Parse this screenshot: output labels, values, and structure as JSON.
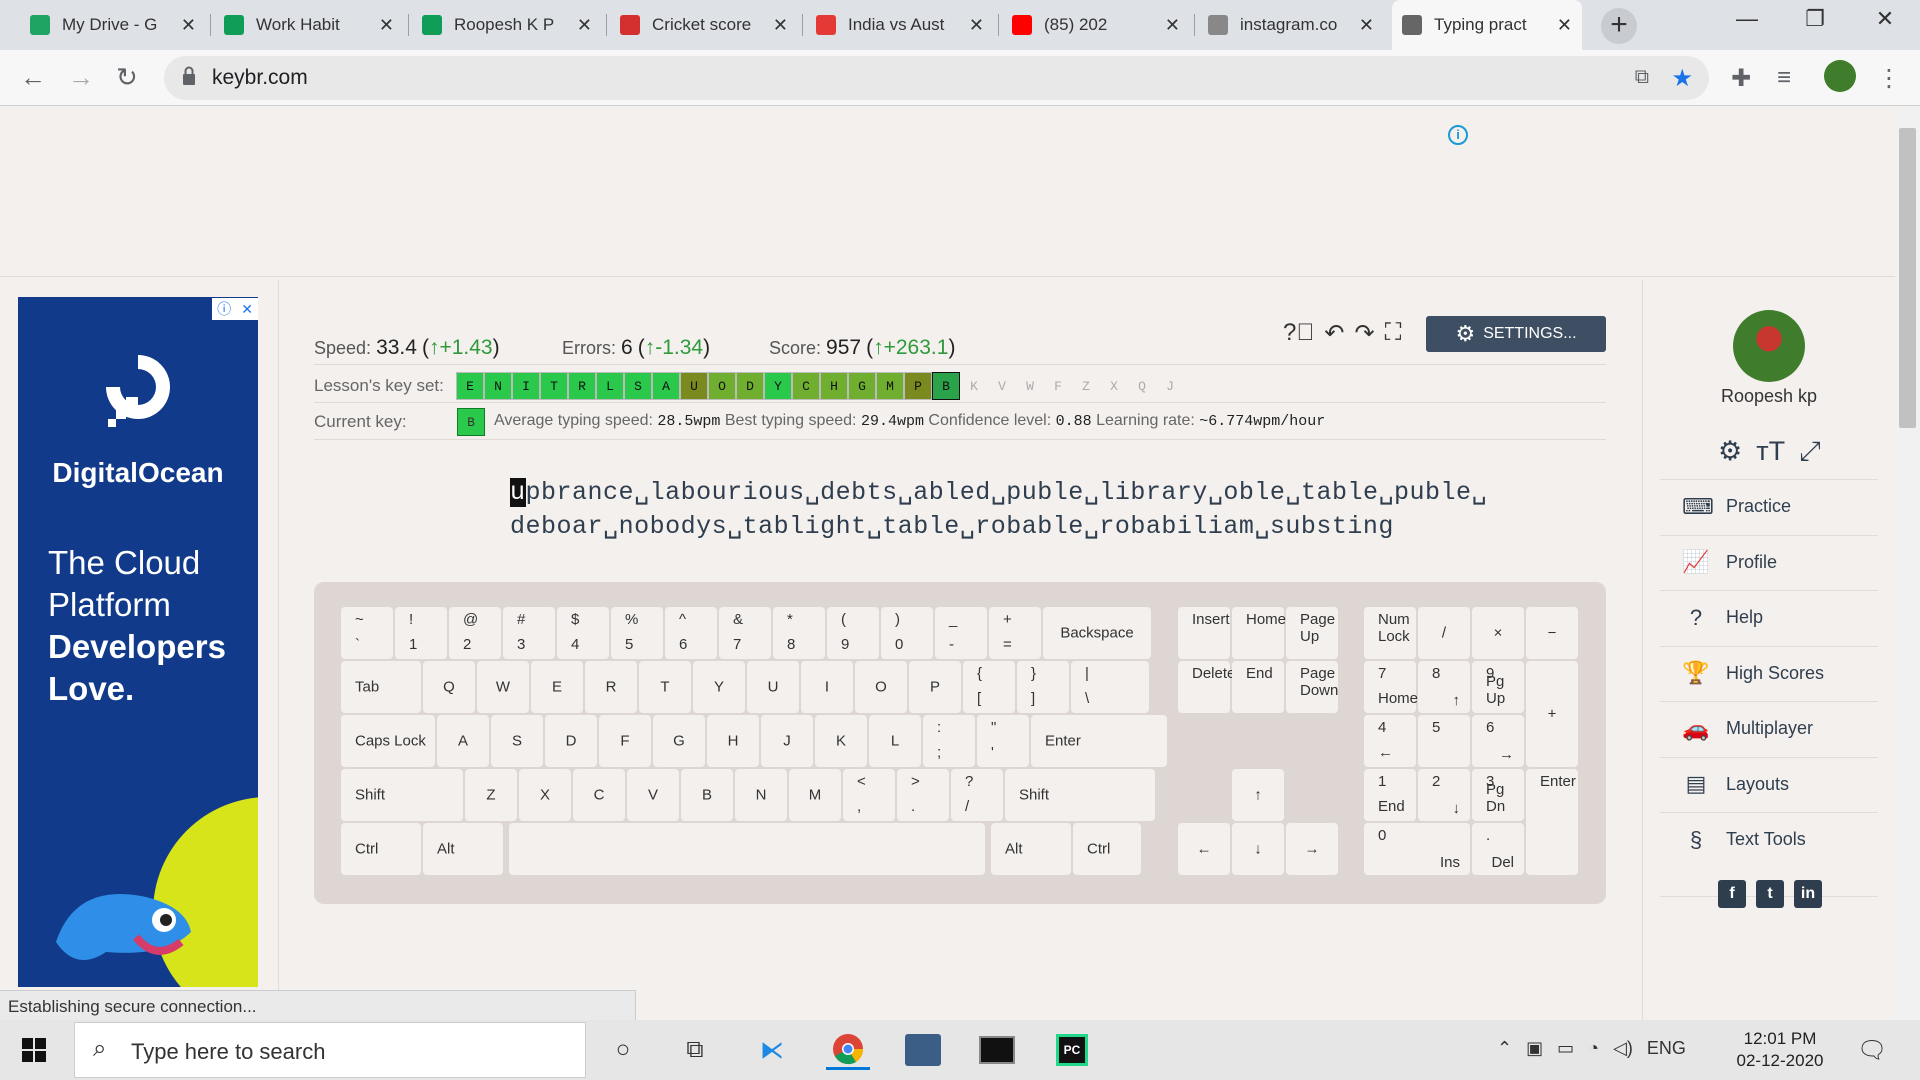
{
  "browser": {
    "tabs": [
      {
        "label": "My Drive - G",
        "favicon": "google-drive-icon",
        "color": "#1fa463"
      },
      {
        "label": "Work Habit",
        "favicon": "google-sheets-icon",
        "color": "#0f9d58"
      },
      {
        "label": "Roopesh K P",
        "favicon": "google-sheets-icon",
        "color": "#0f9d58"
      },
      {
        "label": "Cricket score",
        "favicon": "cricket-icon",
        "color": "#d32f2f"
      },
      {
        "label": "India vs Aust",
        "favicon": "india-vs-aus-icon",
        "color": "#e53935"
      },
      {
        "label": "(85) 202",
        "favicon": "youtube-icon",
        "color": "#ff0000"
      },
      {
        "label": "instagram.co",
        "favicon": "globe-icon",
        "color": "#888888"
      },
      {
        "label": "Typing pract",
        "favicon": "keybr-icon",
        "color": "#666666"
      }
    ],
    "url": "keybr.com"
  },
  "ad": {
    "brand": "DigitalOcean",
    "tag_line1": "The Cloud",
    "tag_line2": "Platform",
    "tag_line3": "Developers",
    "tag_line4": "Love."
  },
  "stats": {
    "speed_label": "Speed:",
    "speed_value": "33.4",
    "speed_delta": "↑+1.43",
    "errors_label": "Errors:",
    "errors_value": "6",
    "errors_delta": "↑-1.34",
    "score_label": "Score:",
    "score_value": "957",
    "score_delta": "↑+263.1"
  },
  "settings_label": "SETTINGS...",
  "lesson": {
    "keyset_label": "Lesson's key set:",
    "keys": [
      {
        "k": "E",
        "s": "g"
      },
      {
        "k": "N",
        "s": "g"
      },
      {
        "k": "I",
        "s": "g"
      },
      {
        "k": "T",
        "s": "g"
      },
      {
        "k": "R",
        "s": "g"
      },
      {
        "k": "L",
        "s": "g"
      },
      {
        "k": "S",
        "s": "g"
      },
      {
        "k": "A",
        "s": "g"
      },
      {
        "k": "U",
        "s": "o"
      },
      {
        "k": "O",
        "s": "m"
      },
      {
        "k": "D",
        "s": "m"
      },
      {
        "k": "Y",
        "s": "g"
      },
      {
        "k": "C",
        "s": "m"
      },
      {
        "k": "H",
        "s": "m"
      },
      {
        "k": "G",
        "s": "m"
      },
      {
        "k": "M",
        "s": "m"
      },
      {
        "k": "P",
        "s": "o"
      },
      {
        "k": "B",
        "s": "c"
      },
      {
        "k": "K",
        "s": "x"
      },
      {
        "k": "V",
        "s": "x"
      },
      {
        "k": "W",
        "s": "x"
      },
      {
        "k": "F",
        "s": "x"
      },
      {
        "k": "Z",
        "s": "x"
      },
      {
        "k": "X",
        "s": "x"
      },
      {
        "k": "Q",
        "s": "x"
      },
      {
        "k": "J",
        "s": "x"
      }
    ],
    "current_label": "Current key:",
    "current_key": "B",
    "avg_label": "Average typing speed:",
    "avg_value": "28.5wpm",
    "best_label": "Best typing speed:",
    "best_value": "29.4wpm",
    "conf_label": "Confidence level:",
    "conf_value": "0.88",
    "rate_label": "Learning rate:",
    "rate_value": "~6.774wpm/hour"
  },
  "text": {
    "cursor": "u",
    "line1_rest": "pbrance␣labourious␣debts␣abled␣puble␣library␣oble␣table␣puble␣",
    "line2": "deboar␣nobodys␣tablight␣table␣robable␣robabiliam␣substing"
  },
  "keyboard": {
    "row1": [
      [
        "~",
        "`"
      ],
      [
        "!",
        "1"
      ],
      [
        "@",
        "2"
      ],
      [
        "#",
        "3"
      ],
      [
        "$",
        "4"
      ],
      [
        "%",
        "5"
      ],
      [
        "^",
        "6"
      ],
      [
        "&",
        "7"
      ],
      [
        "*",
        "8"
      ],
      [
        "(",
        "9"
      ],
      [
        ")",
        "0"
      ],
      [
        "_",
        "-"
      ],
      [
        "+",
        "="
      ]
    ],
    "backspace": "Backspace",
    "tab": "Tab",
    "row2": [
      "Q",
      "W",
      "E",
      "R",
      "T",
      "Y",
      "U",
      "I",
      "O",
      "P"
    ],
    "row2_sym": [
      [
        "{",
        "["
      ],
      [
        "}",
        "]"
      ],
      [
        "|",
        "\\"
      ]
    ],
    "capslock": "Caps Lock",
    "row3": [
      "A",
      "S",
      "D",
      "F",
      "G",
      "H",
      "J",
      "K",
      "L"
    ],
    "row3_sym": [
      [
        ":",
        ";"
      ],
      [
        "\"",
        "'"
      ]
    ],
    "enter": "Enter",
    "shift": "Shift",
    "row4": [
      "Z",
      "X",
      "C",
      "V",
      "B",
      "N",
      "M"
    ],
    "row4_sym": [
      [
        "<",
        ","
      ],
      [
        ">",
        "."
      ],
      [
        "?",
        "/"
      ]
    ],
    "ctrl": "Ctrl",
    "alt": "Alt",
    "nav": {
      "insert": "Insert",
      "home": "Home",
      "pageup": "Page Up",
      "delete": "Delete",
      "end": "End",
      "pagedown": "Page Down"
    },
    "arrows": {
      "up": "↑",
      "left": "←",
      "down": "↓",
      "right": "→"
    },
    "numpad": {
      "numlock": "Num Lock",
      "div": "/",
      "mul": "×",
      "minus": "−",
      "plus": "+",
      "enter": "Enter",
      "n7": [
        "7",
        "Home"
      ],
      "n8": [
        "8",
        "↑"
      ],
      "n9": [
        "9",
        "Pg Up"
      ],
      "n4": [
        "4",
        "←"
      ],
      "n5": [
        "5",
        ""
      ],
      "n6": [
        "6",
        "→"
      ],
      "n1": [
        "1",
        "End"
      ],
      "n2": [
        "2",
        "↓"
      ],
      "n3": [
        "3",
        "Pg Dn"
      ],
      "n0": [
        "0",
        "Ins"
      ],
      "dot": [
        ".",
        "Del"
      ]
    }
  },
  "sidebar": {
    "username": "Roopesh kp",
    "menu": [
      {
        "label": "Practice",
        "icon": "keyboard-icon"
      },
      {
        "label": "Profile",
        "icon": "chart-icon"
      },
      {
        "label": "Help",
        "icon": "help-icon"
      },
      {
        "label": "High Scores",
        "icon": "trophy-icon"
      },
      {
        "label": "Multiplayer",
        "icon": "car-icon"
      },
      {
        "label": "Layouts",
        "icon": "layouts-icon"
      },
      {
        "label": "Text Tools",
        "icon": "section-icon"
      }
    ]
  },
  "status": "Establishing secure connection...",
  "taskbar": {
    "search_placeholder": "Type here to search",
    "lang": "ENG",
    "time": "12:01 PM",
    "date": "02-12-2020"
  },
  "colors": {
    "key_green": "#2ac94c",
    "key_mid": "#6fae2e",
    "key_olive": "#7b8a1e",
    "key_current": "#2aa34a",
    "delta_green": "#2e9a3a"
  }
}
